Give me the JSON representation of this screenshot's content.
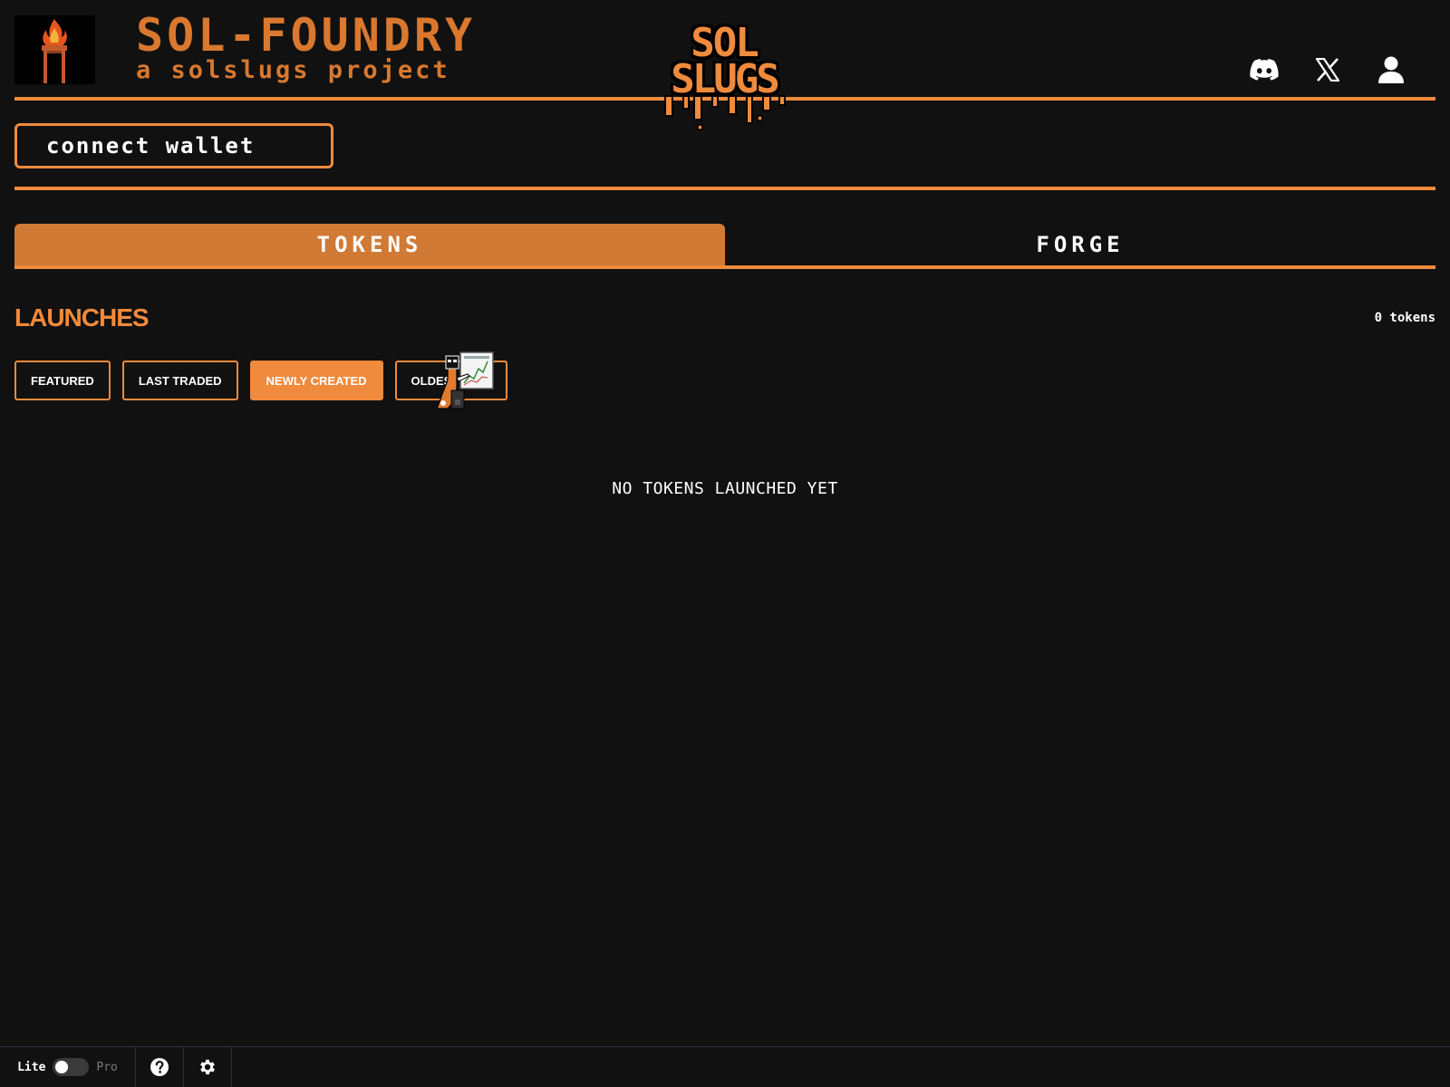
{
  "header": {
    "title": "SOL-FOUNDRY",
    "subtitle": "a solslugs project",
    "slug_logo": {
      "line1": "SOL",
      "line2": "SLUGS"
    },
    "icons": [
      "discord-icon",
      "x-icon",
      "user-icon"
    ]
  },
  "wallet": {
    "connect_label": "connect wallet"
  },
  "tabs": [
    {
      "label": "TOKENS",
      "active": true
    },
    {
      "label": "FORGE",
      "active": false
    }
  ],
  "launches": {
    "title": "LAUNCHES",
    "count_label": "0 tokens",
    "filters": [
      {
        "label": "FEATURED",
        "active": false
      },
      {
        "label": "LAST TRADED",
        "active": false
      },
      {
        "label": "NEWLY CREATED",
        "active": true
      },
      {
        "label": "OLDEST COIN",
        "active": false
      }
    ],
    "empty_message": "NO TOKENS LAUNCHED YET"
  },
  "footer": {
    "mode_lite": "Lite",
    "mode_pro": "Pro",
    "pro_mode_enabled": false
  },
  "colors": {
    "background": "#111111",
    "accent": "#f08a3c",
    "accent_dark": "#d07a35",
    "brand_text": "#d9782e"
  }
}
